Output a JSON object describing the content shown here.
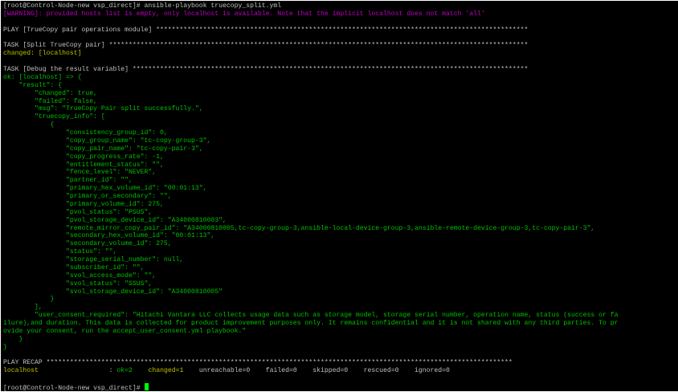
{
  "terminal": {
    "lines": [
      [
        {
          "t": "[root@Control-Node-new vsp_direct]# ansible-playbook truecopy_split.yml",
          "c": "w"
        }
      ],
      [
        {
          "t": "[WARNING]: provided hosts list is empty, only localhost is available. Note that the implicit localhost does not match 'all'",
          "c": "m"
        }
      ],
      [],
      [
        {
          "t": "PLAY [TrueCopy pair operations module] ***********************************************************************************************",
          "c": "w"
        }
      ],
      [],
      [
        {
          "t": "TASK [Split TrueCopy pair] ***********************************************************************************************************",
          "c": "w"
        }
      ],
      [
        {
          "t": "changed: [localhost]",
          "c": "y"
        }
      ],
      [],
      [
        {
          "t": "TASK [Debug the result variable] *****************************************************************************************************",
          "c": "w"
        }
      ],
      [
        {
          "t": "ok: [localhost] => {",
          "c": "g"
        }
      ],
      [
        {
          "t": "    \"result\": {",
          "c": "g"
        }
      ],
      [
        {
          "t": "        \"changed\": true,",
          "c": "g"
        }
      ],
      [
        {
          "t": "        \"failed\": false,",
          "c": "g"
        }
      ],
      [
        {
          "t": "        \"msg\": \"TrueCopy Pair split successfully.\",",
          "c": "g"
        }
      ],
      [
        {
          "t": "        \"truecopy_info\": [",
          "c": "g"
        }
      ],
      [
        {
          "t": "            {",
          "c": "g"
        }
      ],
      [
        {
          "t": "                \"consistency_group_id\": 0,",
          "c": "g"
        }
      ],
      [
        {
          "t": "                \"copy_group_name\": \"tc-copy-group-3\",",
          "c": "g"
        }
      ],
      [
        {
          "t": "                \"copy_pair_name\": \"tc-copy-pair-3\",",
          "c": "g"
        }
      ],
      [
        {
          "t": "                \"copy_progress_rate\": -1,",
          "c": "g"
        }
      ],
      [
        {
          "t": "                \"entitlement_status\": \"\",",
          "c": "g"
        }
      ],
      [
        {
          "t": "                \"fence_level\": \"NEVER\",",
          "c": "g"
        }
      ],
      [
        {
          "t": "                \"partner_id\": \"\",",
          "c": "g"
        }
      ],
      [
        {
          "t": "                \"primary_hex_volume_id\": \"00:01:13\",",
          "c": "g"
        }
      ],
      [
        {
          "t": "                \"primary_or_secondary\": \"\",",
          "c": "g"
        }
      ],
      [
        {
          "t": "                \"primary_volume_id\": 275,",
          "c": "g"
        }
      ],
      [
        {
          "t": "                \"pvol_status\": \"PSUS\",",
          "c": "g"
        }
      ],
      [
        {
          "t": "                \"pvol_storage_device_id\": \"A34000810003\",",
          "c": "g"
        }
      ],
      [
        {
          "t": "                \"remote_mirror_copy_pair_id\": \"A34000810005,tc-copy-group-3,ansible-local-device-group-3,ansible-remote-device-group-3,tc-copy-pair-3\",",
          "c": "g"
        }
      ],
      [
        {
          "t": "                \"secondary_hex_volume_id\": \"00:01:13\",",
          "c": "g"
        }
      ],
      [
        {
          "t": "                \"secondary_volume_id\": 275,",
          "c": "g"
        }
      ],
      [
        {
          "t": "                \"status\": \"\",",
          "c": "g"
        }
      ],
      [
        {
          "t": "                \"storage_serial_number\": null,",
          "c": "g"
        }
      ],
      [
        {
          "t": "                \"subscriber_id\": \"\",",
          "c": "g"
        }
      ],
      [
        {
          "t": "                \"svol_access_mode\": \"\",",
          "c": "g"
        }
      ],
      [
        {
          "t": "                \"svol_status\": \"SSUS\",",
          "c": "g"
        }
      ],
      [
        {
          "t": "                \"svol_storage_device_id\": \"A34000810005\"",
          "c": "g"
        }
      ],
      [
        {
          "t": "            }",
          "c": "g"
        }
      ],
      [
        {
          "t": "        ],",
          "c": "g"
        }
      ],
      [
        {
          "t": "        \"user_consent_required\": \"Hitachi Vantara LLC collects usage data such as storage model, storage serial number, operation name, status (success or fa",
          "c": "g"
        }
      ],
      [
        {
          "t": "ilure),and duration. This data is collected for product improvement purposes only. It remains confidential and it is not shared with any third parties. To pr",
          "c": "g"
        }
      ],
      [
        {
          "t": "ovide your consent, run the accept_user_consent.yml playbook.\"",
          "c": "g"
        }
      ],
      [
        {
          "t": "    }",
          "c": "g"
        }
      ],
      [
        {
          "t": "}",
          "c": "g"
        }
      ],
      [],
      [
        {
          "t": "PLAY RECAP ***********************************************************************************************************************",
          "c": "w"
        }
      ],
      [
        {
          "t": "localhost",
          "c": "y"
        },
        {
          "t": "                  : ",
          "c": "w"
        },
        {
          "t": "ok=2",
          "c": "g"
        },
        {
          "t": "    ",
          "c": "w"
        },
        {
          "t": "changed=1",
          "c": "y"
        },
        {
          "t": "    unreachable=0    failed=0    skipped=0    rescued=0    ignored=0",
          "c": "w"
        }
      ],
      [],
      [
        {
          "t": "[root@Control-Node-new vsp_direct]# ",
          "c": "w"
        }
      ]
    ]
  }
}
